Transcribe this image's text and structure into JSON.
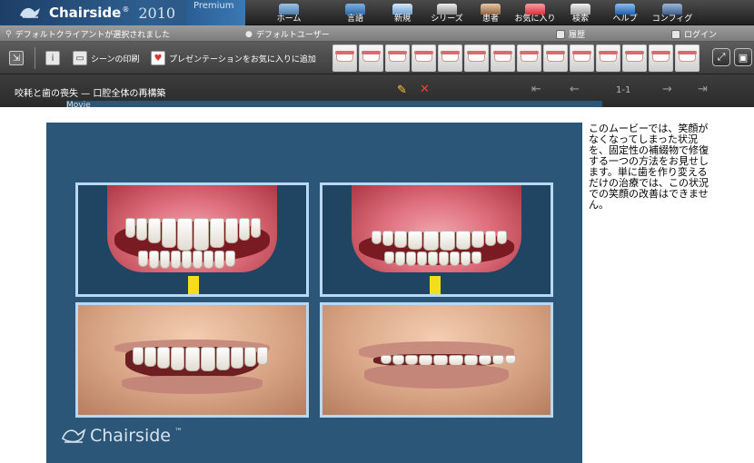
{
  "app": {
    "brand_name": "Chairside",
    "brand_tm": "®",
    "brand_year": "2010",
    "brand_edition": "Premium"
  },
  "nav": [
    {
      "label": "ホーム",
      "icon": "home-chair-icon"
    },
    {
      "label": "言語",
      "icon": "language-icon"
    },
    {
      "label": "新規",
      "icon": "new-icon"
    },
    {
      "label": "シリーズ",
      "icon": "series-icon"
    },
    {
      "label": "患者",
      "icon": "patient-icon"
    },
    {
      "label": "お気に入り",
      "icon": "favorites-icon"
    },
    {
      "label": "検索",
      "icon": "search-icon"
    },
    {
      "label": "ヘルプ",
      "icon": "help-icon"
    },
    {
      "label": "コンフィグ",
      "icon": "config-icon"
    }
  ],
  "status": {
    "client": "デフォルトクライアントが選択されました",
    "user": "デフォルトユーザー",
    "history": "履歴",
    "login": "ログイン"
  },
  "toolbar": {
    "print_label": "シーンの印刷",
    "favorite_label": "プレゼンテーションをお気に入りに追加"
  },
  "title": {
    "text": "咬耗と歯の喪失 — 口腔全体の再構築",
    "badge": "Movie",
    "page": "1-1"
  },
  "movie": {
    "watermark": "Chairside"
  },
  "description": "このムービーでは、笑顔がなくなってしまった状況を、固定性の補綴物で修復する一つの方法をお見せします。単に歯を作り変えるだけの治療では、この状況での笑顔の改善はできません。",
  "colors": {
    "brand_blue": "#2e5f8f",
    "movie_bg": "#2b5677",
    "panel_border": "#b8d8f4",
    "arrow": "#f3de1e",
    "edit": "#ffce2e",
    "delete": "#ff3b3b"
  }
}
